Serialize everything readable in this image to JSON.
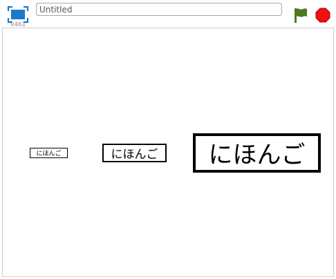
{
  "toolbar": {
    "version": "v461",
    "title_value": "Untitled",
    "fullscreen_icon": "fullscreen-icon",
    "flag_icon": "green-flag-icon",
    "stop_icon": "stop-sign-icon",
    "flag_color": "#4a7a1f",
    "stop_color": "#ee1111",
    "fullscreen_color": "#1b79c9"
  },
  "stage": {
    "labels": {
      "small": "にほんご",
      "medium": "にほんご",
      "large": "にほんご"
    }
  }
}
